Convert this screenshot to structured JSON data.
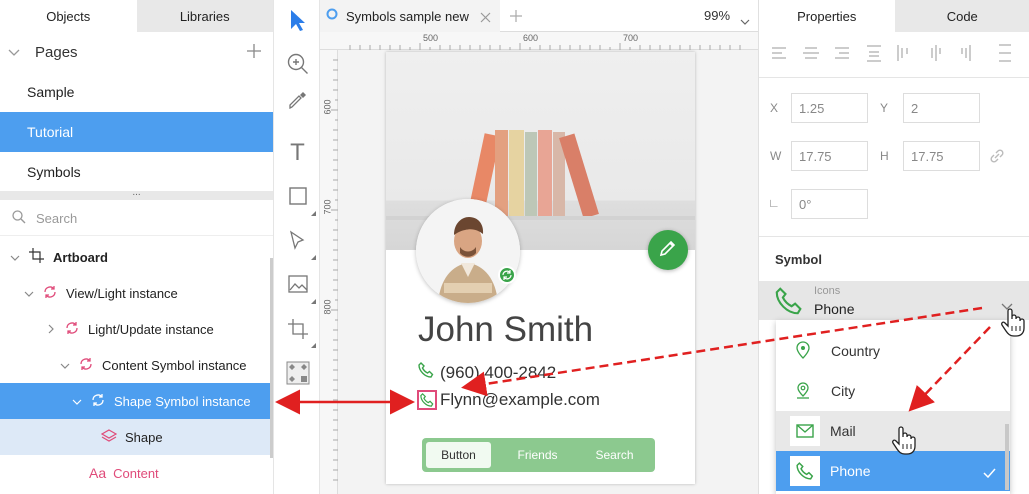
{
  "left_panel": {
    "tabs": [
      "Objects",
      "Libraries"
    ],
    "pages_heading": "Pages",
    "pages": [
      "Sample",
      "Tutorial",
      "Symbols"
    ],
    "splitter_glyph": "...",
    "search_placeholder": "Search",
    "layers": [
      {
        "label": "Artboard",
        "icon": "artboard-icon",
        "selected": false
      },
      {
        "label": "View/Light instance",
        "icon": "symbol-instance-icon",
        "selected": false
      },
      {
        "label": "Light/Update instance",
        "icon": "symbol-instance-icon",
        "selected": false
      },
      {
        "label": "Content Symbol instance",
        "icon": "symbol-instance-icon",
        "selected": false
      },
      {
        "label": "Shape Symbol instance",
        "icon": "symbol-instance-icon",
        "selected": true
      },
      {
        "label": "Shape",
        "icon": "shape-layers-icon",
        "selected": false
      },
      {
        "label": "Content",
        "icon": "text-icon",
        "selected": false
      }
    ],
    "text_icon_glyph": "Aa"
  },
  "toolbar": {
    "tools": [
      "pointer-icon",
      "zoom-icon",
      "eyedropper-icon",
      "text-tool-icon",
      "rectangle-icon",
      "pen-icon",
      "image-icon",
      "crop-icon",
      "components-icon"
    ],
    "text_tool_glyph": "T"
  },
  "canvas": {
    "tab_title": "Symbols sample new",
    "zoom": "99%",
    "ruler_labels_h": [
      "500",
      "600",
      "700"
    ],
    "ruler_labels_v": [
      "600",
      "700",
      "800"
    ],
    "card": {
      "name": "John Smith",
      "phone": "(960) 400-2842",
      "email": "Flynn@example.com",
      "buttons": [
        "Button",
        "Friends",
        "Search"
      ]
    }
  },
  "right_panel": {
    "tabs": [
      "Properties",
      "Code"
    ],
    "x_label": "X",
    "x_value": "1.25",
    "y_label": "Y",
    "y_value": "2",
    "w_label": "W",
    "w_value": "17.75",
    "h_label": "H",
    "h_value": "17.75",
    "rotation_label": "∟",
    "rotation_value": "0°",
    "symbol_heading": "Symbol",
    "symbol_select": {
      "group": "Icons",
      "value": "Phone"
    },
    "dropdown_items": [
      {
        "label": "Country",
        "icon": "globe-pin-icon",
        "selected": false,
        "hovered": false
      },
      {
        "label": "City",
        "icon": "location-pin-icon",
        "selected": false,
        "hovered": false
      },
      {
        "label": "Mail",
        "icon": "mail-icon",
        "selected": false,
        "hovered": true
      },
      {
        "label": "Phone",
        "icon": "phone-icon",
        "selected": true,
        "hovered": false
      }
    ]
  },
  "colors": {
    "selection_blue": "#4d9eef",
    "accent_green": "#3aa44a",
    "symbol_pink": "#e04b7a",
    "annotation_red": "#e02020"
  }
}
